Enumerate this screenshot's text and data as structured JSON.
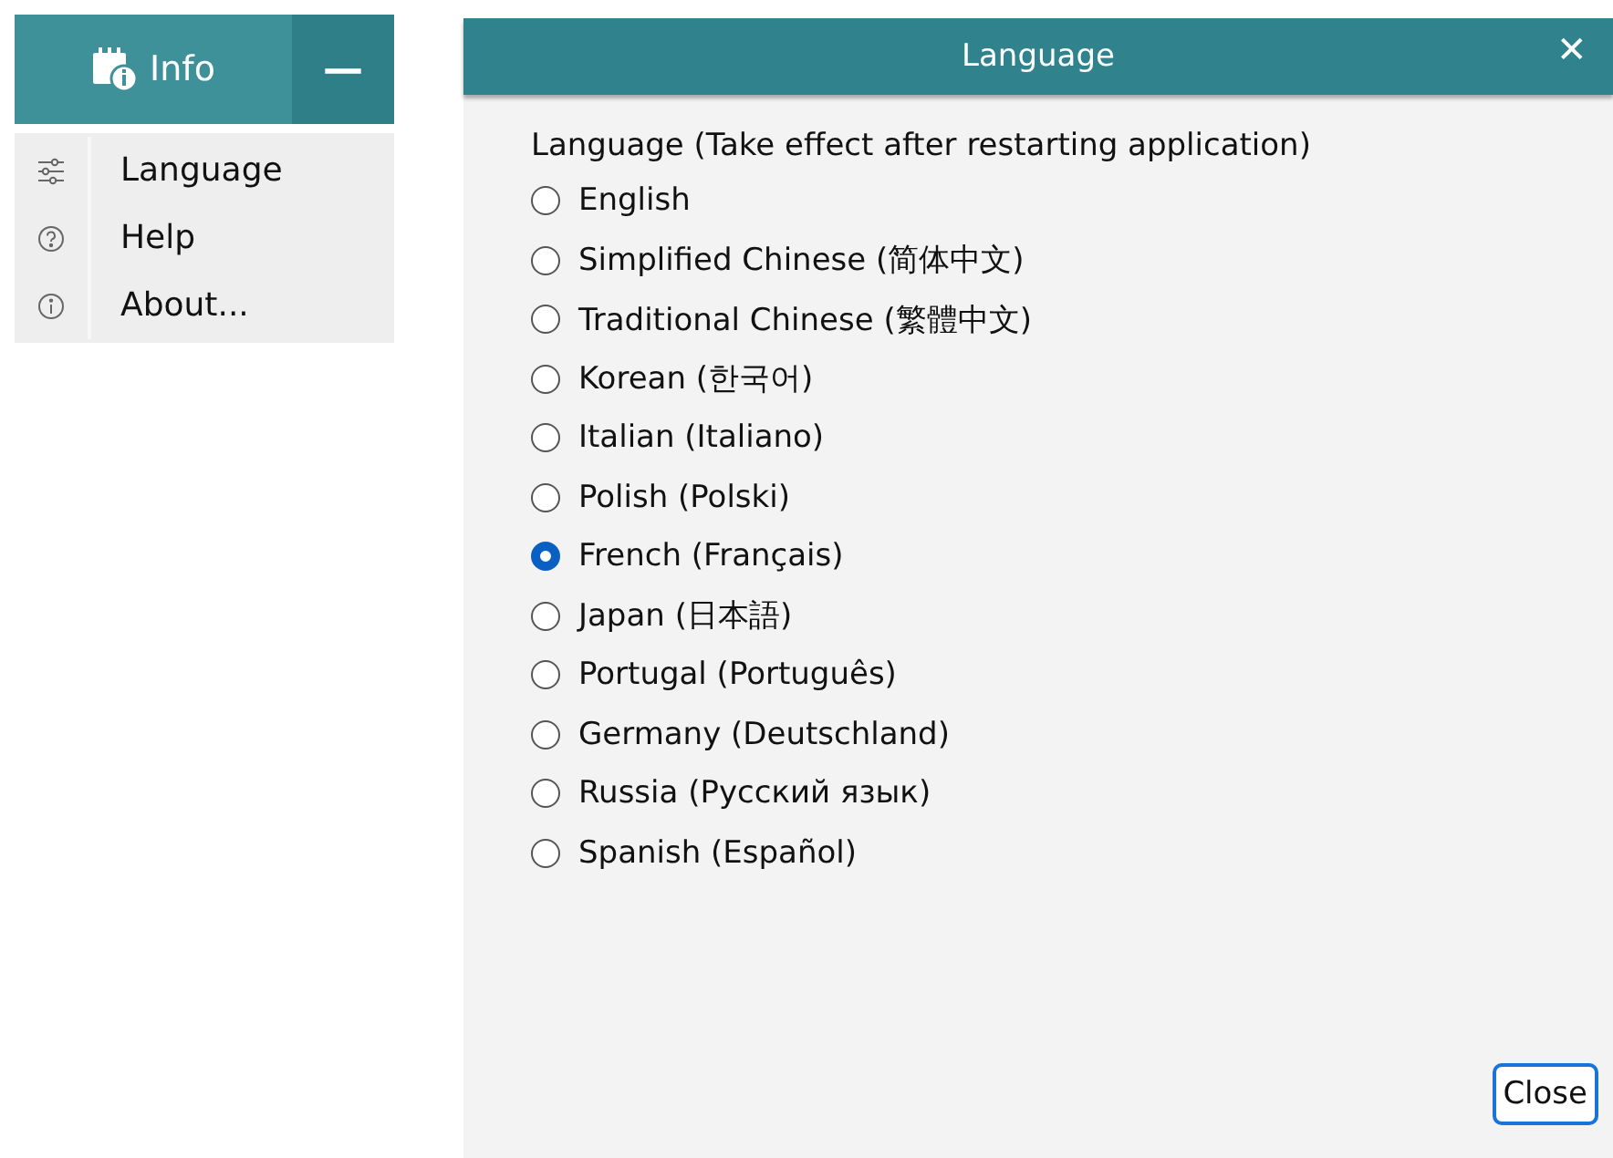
{
  "sidebar": {
    "header_button": "Info",
    "collapse_button": "—",
    "items": [
      {
        "kind": "sliders",
        "label": "Language"
      },
      {
        "kind": "help",
        "label": "Help"
      },
      {
        "kind": "info",
        "label": "About..."
      }
    ]
  },
  "dialog": {
    "title": "Language",
    "close_glyph": "✕",
    "prompt": "Language (Take effect after restarting application)",
    "options": [
      {
        "label": "English",
        "selected": false
      },
      {
        "label": "Simplified Chinese (简体中文)",
        "selected": false
      },
      {
        "label": "Traditional Chinese (繁體中文)",
        "selected": false
      },
      {
        "label": "Korean (한국어)",
        "selected": false
      },
      {
        "label": "Italian (Italiano)",
        "selected": false
      },
      {
        "label": "Polish (Polski)",
        "selected": false
      },
      {
        "label": "French (Français)",
        "selected": true
      },
      {
        "label": "Japan (日本語)",
        "selected": false
      },
      {
        "label": "Portugal (Português)",
        "selected": false
      },
      {
        "label": "Germany (Deutschland)",
        "selected": false
      },
      {
        "label": "Russia (Русский язык)",
        "selected": false
      },
      {
        "label": "Spanish (Español)",
        "selected": false
      }
    ],
    "close_button": "Close"
  }
}
